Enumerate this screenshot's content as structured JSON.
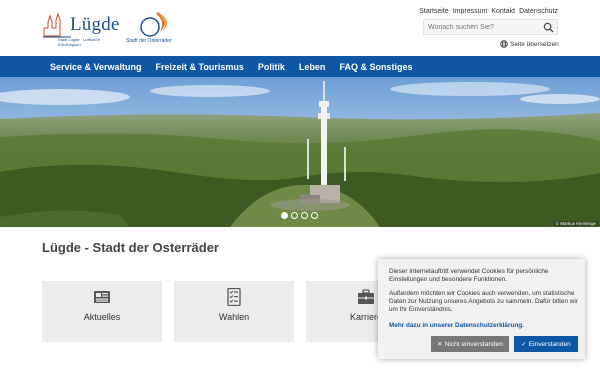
{
  "header": {
    "logo_luegde": {
      "title": "Lügde",
      "subtitle": "Stadt Lügde · Luftkurort Erholungsort"
    },
    "logo_oster": {
      "caption": "Stadt der Osterräder"
    },
    "links": [
      "Startseite",
      "Impressum",
      "Kontakt",
      "Datenschutz"
    ],
    "search": {
      "placeholder": "Wonach suchen Sie?",
      "value": ""
    },
    "translate": "Seite übersetzen"
  },
  "nav": {
    "items": [
      "Service & Verwaltung",
      "Freizeit & Tourismus",
      "Politik",
      "Leben",
      "FAQ & Sonstiges"
    ],
    "color": "#0f56a4"
  },
  "hero": {
    "credit": "© Markus Kleinkirge",
    "slides": 4,
    "active_slide": 1
  },
  "main": {
    "title": "Lügde - Stadt der Osterräder",
    "cards": [
      {
        "label": "Aktuelles",
        "icon": "newspaper-icon"
      },
      {
        "label": "Wahlen",
        "icon": "ballot-checklist-icon"
      },
      {
        "label": "Karriere",
        "icon": "briefcase-icon"
      }
    ]
  },
  "cookie": {
    "text1": "Dieser Internetauftritt verwendet Cookies für persönliche Einstellungen und besondere Funktionen.",
    "text2": "Außerdem möchten wir Cookies auch verwenden, um statistische Daten zur Nutzung unseres Angebots zu sammeln. Dafür bitten wir um Ihr Einverständnis.",
    "more": "Mehr dazu in unserer Datenschutzerklärung.",
    "decline": "Nicht einverstanden",
    "accept": "Einverstanden"
  }
}
